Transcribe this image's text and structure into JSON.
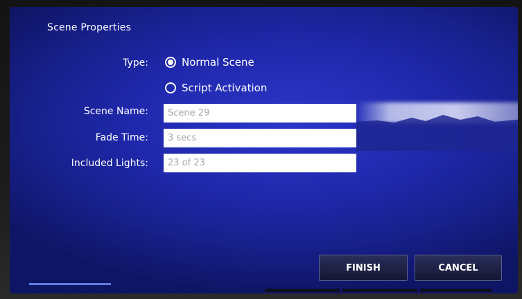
{
  "dialog": {
    "title": "Scene Properties"
  },
  "form": {
    "type_label": "Type:",
    "type_options": [
      {
        "label": "Normal Scene",
        "selected": true
      },
      {
        "label": "Script Activation",
        "selected": false
      }
    ],
    "scene_name_label": "Scene Name:",
    "scene_name_value": "Scene 29",
    "fade_time_label": "Fade Time:",
    "fade_time_value": "3 secs",
    "included_lights_label": "Included Lights:",
    "included_lights_value": "23 of 23"
  },
  "buttons": {
    "finish_label": "FINISH",
    "cancel_label": "CANCEL"
  },
  "colors": {
    "background": "#1f28ab",
    "field_text": "#a6a6b0",
    "button_bg": "#1c1f44"
  }
}
